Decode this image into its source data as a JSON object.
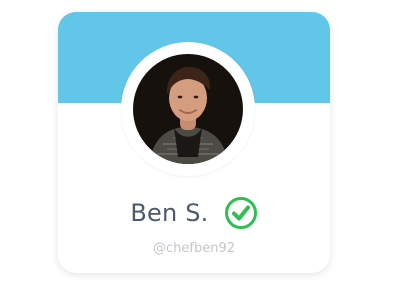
{
  "profile": {
    "name": "Ben S.",
    "handle": "@chefben92",
    "verified": true
  },
  "icons": {
    "avatar": "profile-photo",
    "verified": "verified-check-icon"
  },
  "colors": {
    "header": "#62c6e8",
    "background": "#ffffff",
    "name": "#4a5a6c",
    "handle": "#c1c7cd",
    "verified": "#2fbe52"
  }
}
